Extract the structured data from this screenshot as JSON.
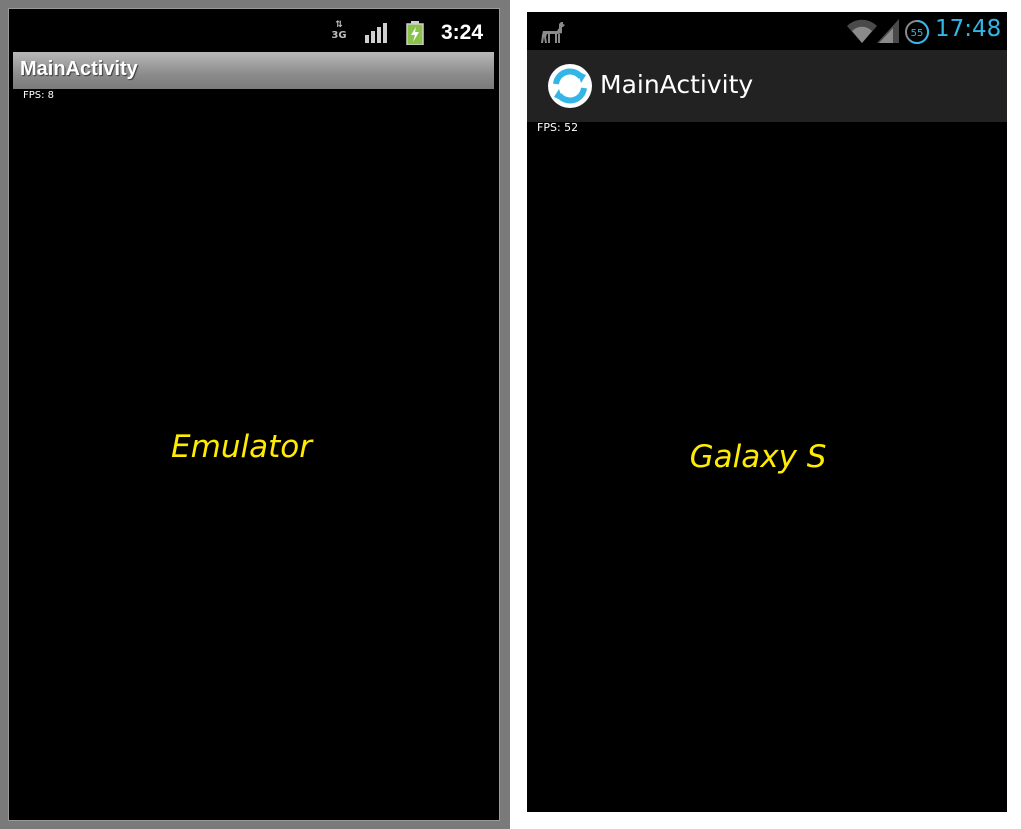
{
  "emulator": {
    "status_bar": {
      "network_label": "3G",
      "time": "3:24",
      "icons": [
        "3g-data-icon",
        "signal-icon",
        "battery-charging-icon"
      ]
    },
    "title": "MainActivity",
    "fps": "FPS: 8",
    "center_label": "Emulator"
  },
  "galaxy": {
    "status_bar": {
      "time": "17:48",
      "battery_level": "55",
      "icons": [
        "llama-icon",
        "wifi-icon",
        "signal-icon",
        "battery-circle-icon"
      ]
    },
    "title": "MainActivity",
    "fps": "FPS: 52",
    "center_label": "Galaxy S",
    "app_icon": "refresh-icon"
  },
  "colors": {
    "holo_blue": "#33b5e5",
    "label_yellow": "#ffec00",
    "battery_green": "#8bc34a"
  }
}
